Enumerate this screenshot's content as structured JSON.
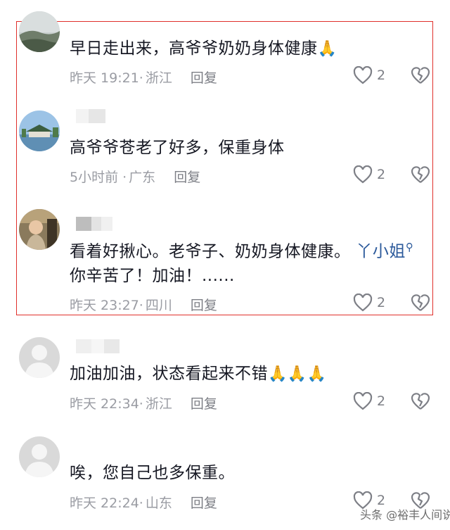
{
  "comments": [
    {
      "text": "早日走出来，高爷爷奶奶身体健康",
      "emoji": "🙏",
      "time": "昨天 19:21·",
      "location": "浙江",
      "reply_label": "回复",
      "likes": "2"
    },
    {
      "text": "高爷爷苍老了好多，保重身体",
      "time": "5小时前 ·",
      "location": "广东",
      "reply_label": "回复",
      "likes": "2"
    },
    {
      "text_line1": "看着好揪心。老爷子、奶奶身体健康。",
      "mention": "丫小姐",
      "text_line2": "你辛苦了！加油！......",
      "time": "昨天 23:27·",
      "location": "四川",
      "reply_label": "回复",
      "likes": "2"
    },
    {
      "text": "加油加油，状态看起来不错",
      "emoji": "🙏🙏🙏",
      "time": "昨天 22:34·",
      "location": "浙江",
      "reply_label": "回复",
      "likes": "2"
    },
    {
      "text": "唉，您自己也多保重。",
      "time": "昨天 22:24·",
      "location": "山东",
      "reply_label": "回复",
      "likes": "2"
    }
  ],
  "watermark": "头条 @裕丰人间说",
  "colors": {
    "highlight_border": "#e0302b",
    "meta_text": "#9a9ca3",
    "mention": "#2c5a9b"
  }
}
